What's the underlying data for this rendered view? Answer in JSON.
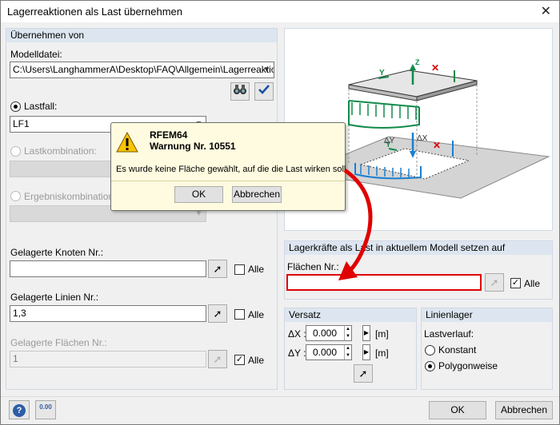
{
  "window": {
    "title": "Lagerreaktionen als Last übernehmen",
    "close_glyph": "✕"
  },
  "left": {
    "group_title": "Übernehmen von",
    "model_label": "Modelldatei:",
    "model_path": "C:\\Users\\LanghammerA\\Desktop\\FAQ\\Allgemein\\Lagerreaktione",
    "loadcase_label": "Lastfall:",
    "loadcase_value": "LF1",
    "loadcombo_label": "Lastkombination:",
    "resultcombo_label": "Ergebniskombination:",
    "nodes_label": "Gelagerte Knoten Nr.:",
    "nodes_value": "",
    "nodes_all": "Alle",
    "lines_label": "Gelagerte Linien Nr.:",
    "lines_value": "1,3",
    "lines_all": "Alle",
    "surfaces_label": "Gelagerte Flächen Nr.:",
    "surfaces_value": "1",
    "surfaces_all": "Alle"
  },
  "right": {
    "set_group_title": "Lagerkräfte als Last in aktuellem Modell setzen auf",
    "surfaces_label": "Flächen Nr.:",
    "surfaces_value": "",
    "all_label": "Alle",
    "offset_title": "Versatz",
    "dx_label": "ΔX :",
    "dx_value": "0.000",
    "dx_unit": "[m]",
    "dy_label": "ΔY :",
    "dy_value": "0.000",
    "dy_unit": "[m]",
    "line_support_title": "Linienlager",
    "load_dist_label": "Lastverlauf:",
    "const_label": "Konstant",
    "poly_label": "Polygonweise"
  },
  "diagram": {
    "label_dy": "ΔY",
    "label_dx": "ΔX",
    "label_y": "Y",
    "label_z": "Z"
  },
  "message": {
    "app": "RFEM64",
    "warning": "Warnung Nr. 10551",
    "text": "Es wurde keine Fläche gewählt, auf die die Last wirken soll.",
    "ok": "OK",
    "cancel": "Abbrechen"
  },
  "footer": {
    "ok": "OK",
    "cancel": "Abbrechen",
    "calc_value": "0.00"
  },
  "colors": {
    "highlight_red": "#e00000",
    "title_band": "#dde6f0"
  }
}
